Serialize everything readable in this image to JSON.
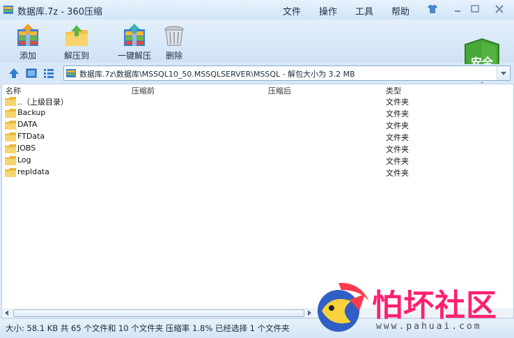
{
  "window": {
    "title": "数据库.7z - 360压缩",
    "menu": [
      "文件",
      "操作",
      "工具",
      "帮助"
    ]
  },
  "toolbar": {
    "items": [
      {
        "label": "添加",
        "icon": "add-archive-icon"
      },
      {
        "label": "解压到",
        "icon": "extract-to-icon"
      },
      {
        "label": "一键解压",
        "icon": "one-click-extract-icon"
      },
      {
        "label": "删除",
        "icon": "trash-icon"
      }
    ],
    "security_badge": "安全"
  },
  "path": {
    "text": "数据库.7z\\数据库\\MSSQL10_50.MSSQLSERVER\\MSSQL - 解包大小为 3.2 MB"
  },
  "file_list": {
    "columns": [
      "名称",
      "压缩前",
      "压缩后",
      "类型"
    ],
    "rows": [
      {
        "name": "..（上级目录）",
        "type": "文件夹"
      },
      {
        "name": "Backup",
        "type": "文件夹"
      },
      {
        "name": "DATA",
        "type": "文件夹"
      },
      {
        "name": "FTData",
        "type": "文件夹"
      },
      {
        "name": "JOBS",
        "type": "文件夹"
      },
      {
        "name": "Log",
        "type": "文件夹"
      },
      {
        "name": "repldata",
        "type": "文件夹"
      }
    ]
  },
  "status": {
    "text": "大小: 58.1 KB 共 65 个文件和 10 个文件夹 压缩率 1.8% 已经选择 1 个文件夹"
  },
  "watermark": {
    "name": "怕坏社区",
    "url": "www.pahuai.com"
  },
  "colors": {
    "accent": "#2f7fd3",
    "shield": "#47a838",
    "brand": "#ff1f6e"
  }
}
